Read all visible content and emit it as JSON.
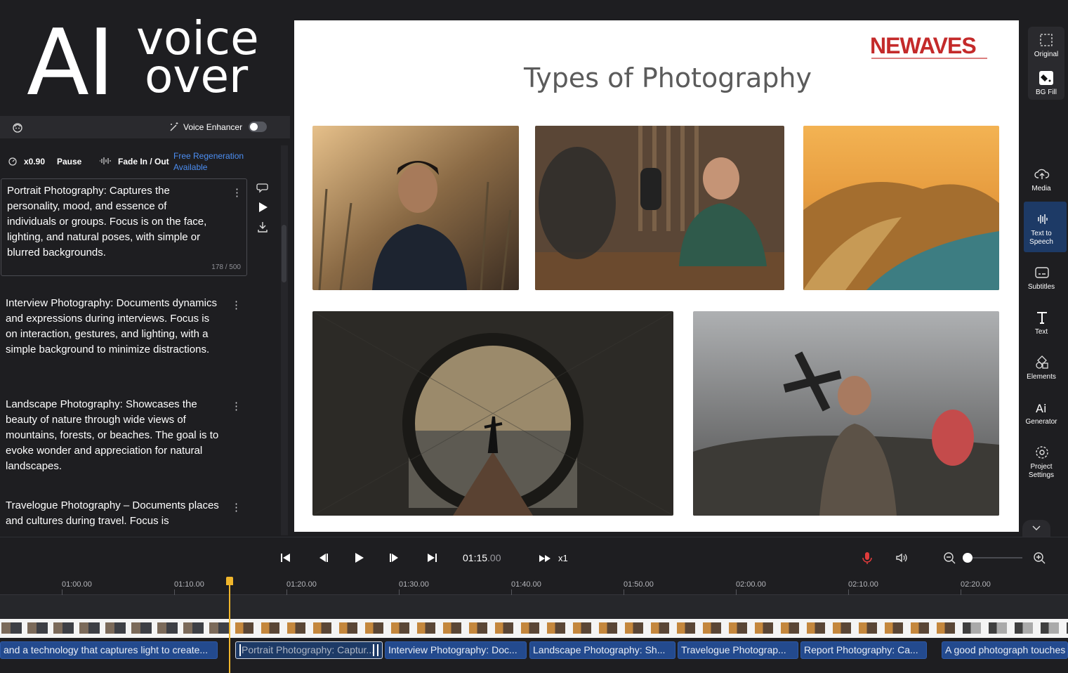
{
  "brand": {
    "ai": "AI",
    "voice": "voice",
    "over": "over"
  },
  "voice_bar": {
    "enhancer_label": "Voice Enhancer",
    "enhancer_on": false
  },
  "controls": {
    "speed": "x0.90",
    "pause": "Pause",
    "fade": "Fade In / Out",
    "regen_line1": "Free Regeneration",
    "regen_line2": "Available"
  },
  "segments": [
    {
      "text": "Portrait Photography: Captures the personality, mood, and essence of individuals or groups. Focus is on the face, lighting, and natural poses, with simple or blurred backgrounds.",
      "count": "178 / 500"
    },
    {
      "text": "Interview Photography: Documents dynamics and expressions during interviews. Focus is on interaction, gestures, and lighting, with a simple background to minimize distractions."
    },
    {
      "text": "Landscape Photography: Showcases the beauty of nature through wide views of mountains, forests, or beaches. The goal is to evoke wonder and appreciation for natural landscapes."
    },
    {
      "text": "Travelogue Photography – Documents places and cultures during travel. Focus is"
    }
  ],
  "slide": {
    "logo": "NEWAVES",
    "title": "Types of Photography"
  },
  "rail": {
    "original": "Original",
    "bg_fill": "BG Fill",
    "items": [
      {
        "label": "Media",
        "icon": "cloud-upload-icon"
      },
      {
        "label": "Text to Speech",
        "icon": "waveform-icon"
      },
      {
        "label": "Subtitles",
        "icon": "subtitles-icon"
      },
      {
        "label": "Text",
        "icon": "text-t-icon"
      },
      {
        "label": "Elements",
        "icon": "shapes-icon"
      },
      {
        "label": "Generator",
        "icon": "ai-generator-icon"
      },
      {
        "label": "Project Settings",
        "icon": "gear-icon"
      }
    ]
  },
  "transport": {
    "time_main": "01:15",
    "time_ms": ".00",
    "speed": "x1"
  },
  "ruler": [
    "01:00.00",
    "01:10.00",
    "01:20.00",
    "01:30.00",
    "01:40.00",
    "01:50.00",
    "02:00.00",
    "02:10.00",
    "02:20.00"
  ],
  "subtitle_clips": [
    "and a technology that captures light to create...",
    "Portrait Photography: Captur...",
    "Interview Photography: Doc...",
    "Landscape Photography: Sh...",
    "Travelogue Photograp...",
    "Report Photography: Ca...",
    "A good photograph touches"
  ],
  "colors": {
    "accent": "#4c8ef2",
    "playhead": "#f0b62c",
    "clip": "#234a8e",
    "logo": "#c42a2a"
  }
}
